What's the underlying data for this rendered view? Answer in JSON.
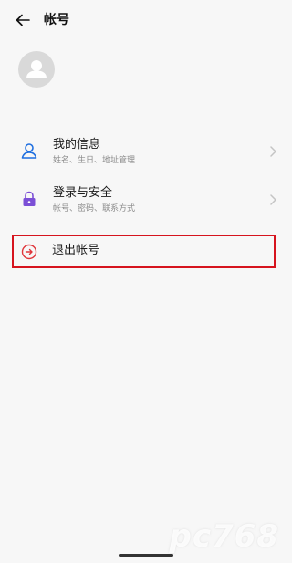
{
  "header": {
    "title": "帐号"
  },
  "menu": [
    {
      "label": "我的信息",
      "sub": "姓名、生日、地址管理",
      "icon": "person-icon"
    },
    {
      "label": "登录与安全",
      "sub": "帐号、密码、联系方式",
      "icon": "lock-icon"
    }
  ],
  "logout": {
    "label": "退出帐号",
    "highlight_color": "#d6141e"
  },
  "watermark": "pc768",
  "colors": {
    "accent_blue": "#1f6fe0",
    "accent_purple": "#7b4fd6",
    "logout_red": "#e0353a"
  }
}
